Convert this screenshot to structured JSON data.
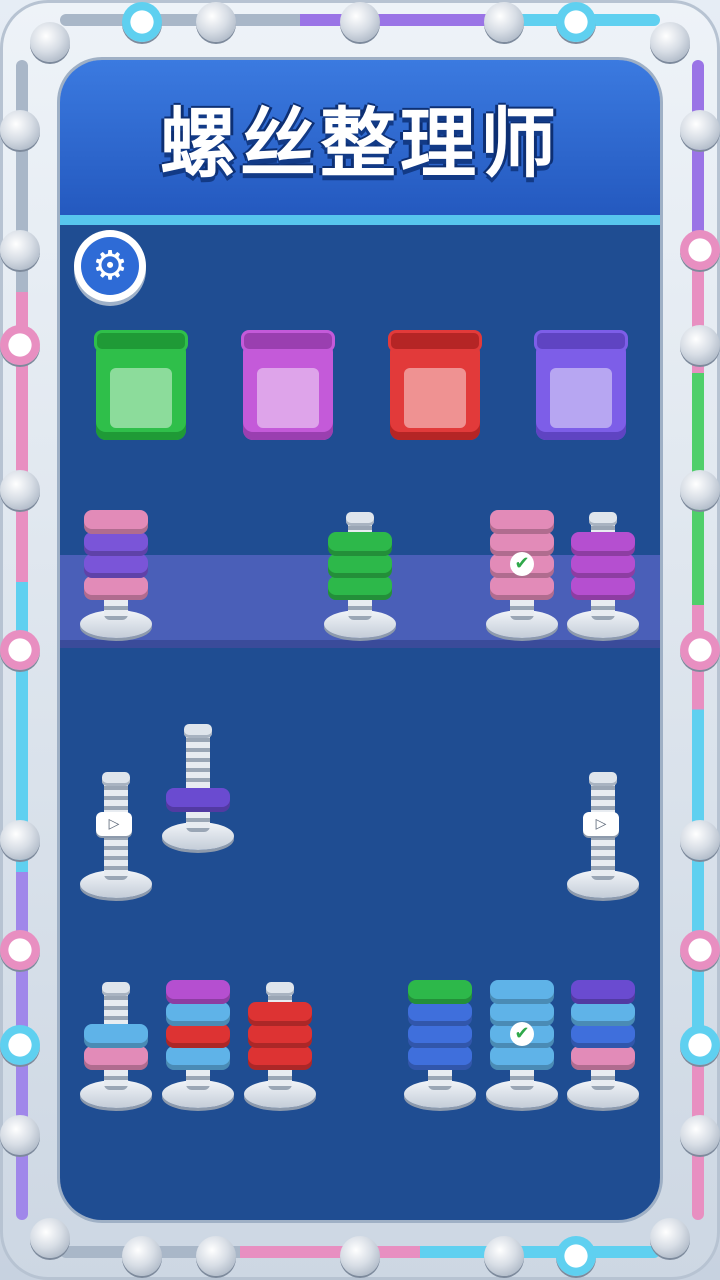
{
  "game": {
    "title": "螺丝整理师",
    "settings_icon": "gear-icon"
  },
  "boxes": [
    {
      "color": "#2fbf4a",
      "dark": "#1f9a36"
    },
    {
      "color": "#c45ad9",
      "dark": "#9a3fb0"
    },
    {
      "color": "#e23a3a",
      "dark": "#b52525"
    },
    {
      "color": "#7d5ee8",
      "dark": "#5f44c2"
    }
  ],
  "bolts": [
    {
      "row": 1,
      "nuts": [
        "pink",
        "purple",
        "purple",
        "pink"
      ],
      "completed": false,
      "locked": false
    },
    {
      "row": 1,
      "nuts": [
        "green",
        "green",
        "green"
      ],
      "completed": false,
      "locked": false
    },
    {
      "row": 1,
      "nuts": [
        "pink",
        "pink",
        "pink",
        "pink"
      ],
      "completed": true,
      "locked": false
    },
    {
      "row": 1,
      "nuts": [
        "magenta",
        "magenta",
        "magenta"
      ],
      "completed": false,
      "locked": false
    },
    {
      "row": 2,
      "nuts": [],
      "completed": false,
      "locked": true
    },
    {
      "row": 2,
      "nuts": [
        "violet"
      ],
      "completed": false,
      "locked": false
    },
    {
      "row": 2,
      "nuts": [],
      "completed": false,
      "locked": true
    },
    {
      "row": 3,
      "nuts": [
        "pink",
        "lightblue"
      ],
      "completed": false,
      "locked": false
    },
    {
      "row": 3,
      "nuts": [
        "lightblue",
        "red",
        "lightblue",
        "magenta"
      ],
      "completed": false,
      "locked": false
    },
    {
      "row": 3,
      "nuts": [
        "red",
        "red",
        "red"
      ],
      "completed": false,
      "locked": false
    },
    {
      "row": 3,
      "nuts": [
        "blue",
        "blue",
        "blue",
        "green"
      ],
      "completed": false,
      "locked": false
    },
    {
      "row": 3,
      "nuts": [
        "lightblue",
        "lightblue",
        "lightblue",
        "lightblue"
      ],
      "completed": true,
      "locked": false
    },
    {
      "row": 3,
      "nuts": [
        "pink",
        "blue",
        "lightblue",
        "violet"
      ],
      "completed": false,
      "locked": false
    }
  ],
  "nut_colors": {
    "pink": "#e28bb8",
    "purple": "#7a55d8",
    "green": "#2db84a",
    "magenta": "#b54fd0",
    "violet": "#6a4bd0",
    "lightblue": "#5fb3e8",
    "red": "#dd3333",
    "blue": "#3f6fdc"
  }
}
